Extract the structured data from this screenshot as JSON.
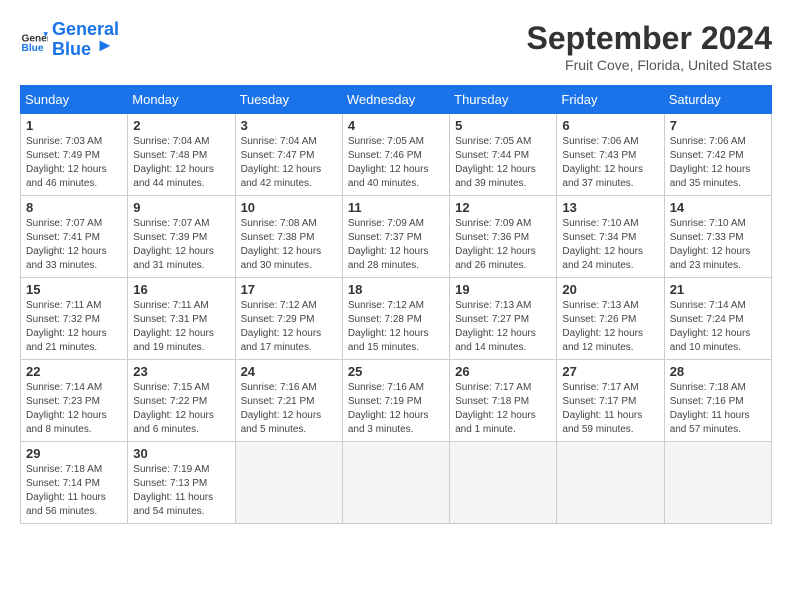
{
  "header": {
    "logo_line1": "General",
    "logo_line2": "Blue",
    "month": "September 2024",
    "location": "Fruit Cove, Florida, United States"
  },
  "weekdays": [
    "Sunday",
    "Monday",
    "Tuesday",
    "Wednesday",
    "Thursday",
    "Friday",
    "Saturday"
  ],
  "weeks": [
    [
      {
        "day": "1",
        "details": "Sunrise: 7:03 AM\nSunset: 7:49 PM\nDaylight: 12 hours\nand 46 minutes."
      },
      {
        "day": "2",
        "details": "Sunrise: 7:04 AM\nSunset: 7:48 PM\nDaylight: 12 hours\nand 44 minutes."
      },
      {
        "day": "3",
        "details": "Sunrise: 7:04 AM\nSunset: 7:47 PM\nDaylight: 12 hours\nand 42 minutes."
      },
      {
        "day": "4",
        "details": "Sunrise: 7:05 AM\nSunset: 7:46 PM\nDaylight: 12 hours\nand 40 minutes."
      },
      {
        "day": "5",
        "details": "Sunrise: 7:05 AM\nSunset: 7:44 PM\nDaylight: 12 hours\nand 39 minutes."
      },
      {
        "day": "6",
        "details": "Sunrise: 7:06 AM\nSunset: 7:43 PM\nDaylight: 12 hours\nand 37 minutes."
      },
      {
        "day": "7",
        "details": "Sunrise: 7:06 AM\nSunset: 7:42 PM\nDaylight: 12 hours\nand 35 minutes."
      }
    ],
    [
      {
        "day": "8",
        "details": "Sunrise: 7:07 AM\nSunset: 7:41 PM\nDaylight: 12 hours\nand 33 minutes."
      },
      {
        "day": "9",
        "details": "Sunrise: 7:07 AM\nSunset: 7:39 PM\nDaylight: 12 hours\nand 31 minutes."
      },
      {
        "day": "10",
        "details": "Sunrise: 7:08 AM\nSunset: 7:38 PM\nDaylight: 12 hours\nand 30 minutes."
      },
      {
        "day": "11",
        "details": "Sunrise: 7:09 AM\nSunset: 7:37 PM\nDaylight: 12 hours\nand 28 minutes."
      },
      {
        "day": "12",
        "details": "Sunrise: 7:09 AM\nSunset: 7:36 PM\nDaylight: 12 hours\nand 26 minutes."
      },
      {
        "day": "13",
        "details": "Sunrise: 7:10 AM\nSunset: 7:34 PM\nDaylight: 12 hours\nand 24 minutes."
      },
      {
        "day": "14",
        "details": "Sunrise: 7:10 AM\nSunset: 7:33 PM\nDaylight: 12 hours\nand 23 minutes."
      }
    ],
    [
      {
        "day": "15",
        "details": "Sunrise: 7:11 AM\nSunset: 7:32 PM\nDaylight: 12 hours\nand 21 minutes."
      },
      {
        "day": "16",
        "details": "Sunrise: 7:11 AM\nSunset: 7:31 PM\nDaylight: 12 hours\nand 19 minutes."
      },
      {
        "day": "17",
        "details": "Sunrise: 7:12 AM\nSunset: 7:29 PM\nDaylight: 12 hours\nand 17 minutes."
      },
      {
        "day": "18",
        "details": "Sunrise: 7:12 AM\nSunset: 7:28 PM\nDaylight: 12 hours\nand 15 minutes."
      },
      {
        "day": "19",
        "details": "Sunrise: 7:13 AM\nSunset: 7:27 PM\nDaylight: 12 hours\nand 14 minutes."
      },
      {
        "day": "20",
        "details": "Sunrise: 7:13 AM\nSunset: 7:26 PM\nDaylight: 12 hours\nand 12 minutes."
      },
      {
        "day": "21",
        "details": "Sunrise: 7:14 AM\nSunset: 7:24 PM\nDaylight: 12 hours\nand 10 minutes."
      }
    ],
    [
      {
        "day": "22",
        "details": "Sunrise: 7:14 AM\nSunset: 7:23 PM\nDaylight: 12 hours\nand 8 minutes."
      },
      {
        "day": "23",
        "details": "Sunrise: 7:15 AM\nSunset: 7:22 PM\nDaylight: 12 hours\nand 6 minutes."
      },
      {
        "day": "24",
        "details": "Sunrise: 7:16 AM\nSunset: 7:21 PM\nDaylight: 12 hours\nand 5 minutes."
      },
      {
        "day": "25",
        "details": "Sunrise: 7:16 AM\nSunset: 7:19 PM\nDaylight: 12 hours\nand 3 minutes."
      },
      {
        "day": "26",
        "details": "Sunrise: 7:17 AM\nSunset: 7:18 PM\nDaylight: 12 hours\nand 1 minute."
      },
      {
        "day": "27",
        "details": "Sunrise: 7:17 AM\nSunset: 7:17 PM\nDaylight: 11 hours\nand 59 minutes."
      },
      {
        "day": "28",
        "details": "Sunrise: 7:18 AM\nSunset: 7:16 PM\nDaylight: 11 hours\nand 57 minutes."
      }
    ],
    [
      {
        "day": "29",
        "details": "Sunrise: 7:18 AM\nSunset: 7:14 PM\nDaylight: 11 hours\nand 56 minutes."
      },
      {
        "day": "30",
        "details": "Sunrise: 7:19 AM\nSunset: 7:13 PM\nDaylight: 11 hours\nand 54 minutes."
      },
      {
        "day": "",
        "details": ""
      },
      {
        "day": "",
        "details": ""
      },
      {
        "day": "",
        "details": ""
      },
      {
        "day": "",
        "details": ""
      },
      {
        "day": "",
        "details": ""
      }
    ]
  ]
}
